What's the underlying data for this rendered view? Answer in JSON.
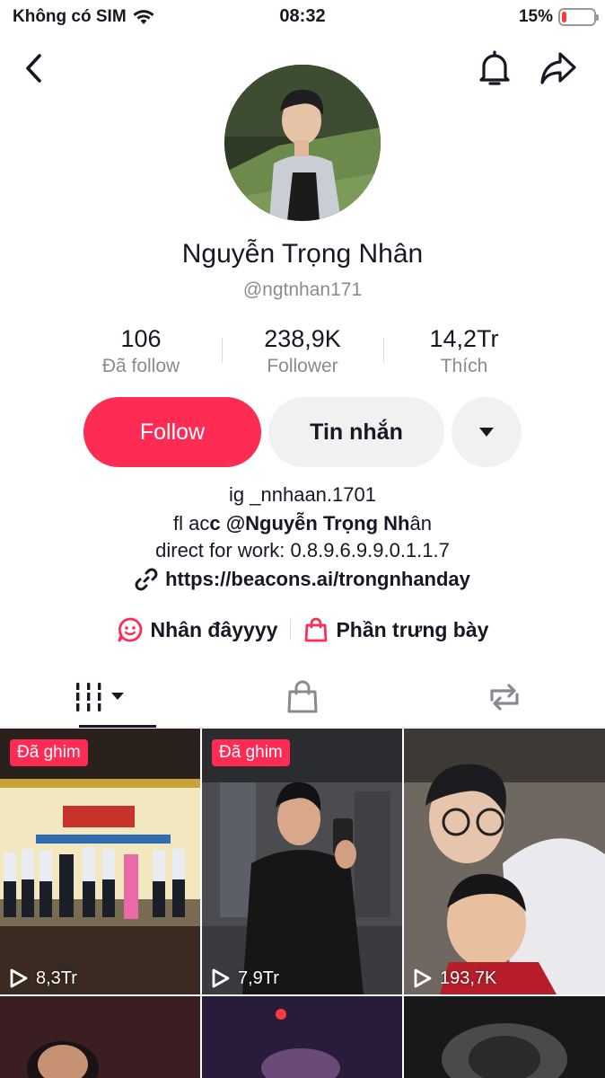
{
  "status_bar": {
    "carrier": "Không có SIM",
    "time": "08:32",
    "battery_percent": "15%",
    "battery_level": 0.15
  },
  "profile": {
    "name": "Nguyễn Trọng Nhân",
    "handle": "@ngtnhan171",
    "stats": [
      {
        "value": "106",
        "label": "Đã follow"
      },
      {
        "value": "238,9K",
        "label": "Follower"
      },
      {
        "value": "14,2Tr",
        "label": "Thích"
      }
    ]
  },
  "actions": {
    "follow_label": "Follow",
    "message_label": "Tin nhắn"
  },
  "bio": {
    "line1": "ig _nnhaan.1701",
    "line2_prefix": "fl ac",
    "line2_bold": "c @Nguyễn Trọng Nh",
    "line2_suffix": "ân",
    "line3": "direct for work: 0.8.9.6.9.9.0.1.1.7",
    "link": "https://beacons.ai/trongnhanday"
  },
  "chips": [
    {
      "label": "Nhân đâyyyy",
      "icon": "smile-icon"
    },
    {
      "label": "Phần trưng bày",
      "icon": "shopping-bag-icon"
    }
  ],
  "tabs": [
    {
      "name": "videos-grid-icon",
      "active": true
    },
    {
      "name": "shop-bag-icon",
      "active": false
    },
    {
      "name": "repost-icon",
      "active": false
    }
  ],
  "videos": [
    {
      "pinned_label": "Đã ghim",
      "views": "8,3Tr"
    },
    {
      "pinned_label": "Đã ghim",
      "views": "7,9Tr"
    },
    {
      "pinned_label": "",
      "views": "193,7K"
    }
  ],
  "colors": {
    "accent": "#fe2c55",
    "text": "#161823",
    "muted": "#8a8b91",
    "button_gray": "#f1f1f2"
  }
}
